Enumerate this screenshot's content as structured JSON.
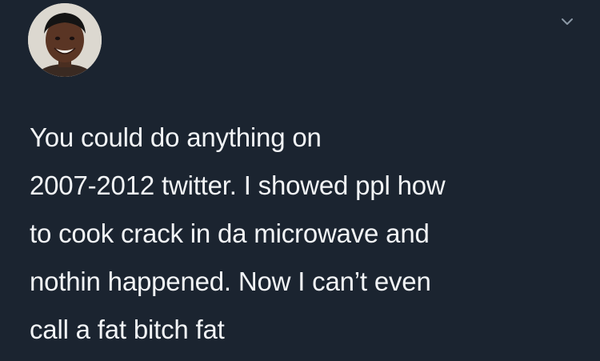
{
  "tweet": {
    "avatar_icon": "profile-photo",
    "menu_icon": "chevron-down-icon",
    "text": "You could do anything on\n2007-2012 twitter. I showed ppl how\nto cook crack in da microwave and\nnothin happened. Now I can’t even\ncall a fat bitch fat"
  },
  "colors": {
    "background": "#1b2430",
    "text": "#f2f4f6",
    "chevron": "#8b98a5"
  }
}
